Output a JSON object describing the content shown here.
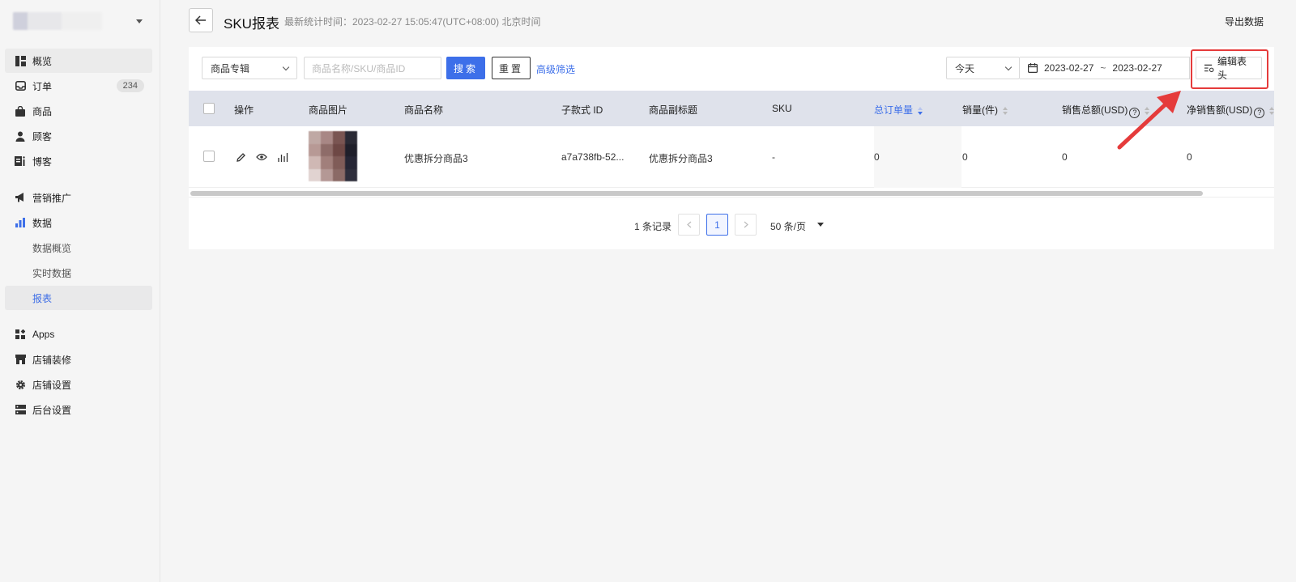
{
  "sidebar": {
    "items": [
      {
        "label": "概览",
        "icon": "dashboard-icon"
      },
      {
        "label": "订单",
        "icon": "inbox-icon",
        "badge": "234"
      },
      {
        "label": "商品",
        "icon": "bag-icon"
      },
      {
        "label": "顾客",
        "icon": "person-icon"
      },
      {
        "label": "博客",
        "icon": "blog-icon"
      }
    ],
    "items2": [
      {
        "label": "营销推广",
        "icon": "megaphone-icon"
      },
      {
        "label": "数据",
        "icon": "bar-chart-icon"
      }
    ],
    "data_sub": [
      {
        "label": "数据概览"
      },
      {
        "label": "实时数据"
      },
      {
        "label": "报表"
      }
    ],
    "items3": [
      {
        "label": "Apps",
        "icon": "apps-icon"
      },
      {
        "label": "店铺装修",
        "icon": "store-icon"
      },
      {
        "label": "店铺设置",
        "icon": "gear-icon"
      },
      {
        "label": "后台设置",
        "icon": "server-icon"
      }
    ]
  },
  "header": {
    "title": "SKU报表",
    "subtitle": "最新统计时间：2023-02-27 15:05:47(UTC+08:00) 北京时间",
    "export": "导出数据"
  },
  "filters": {
    "category_select": "商品专辑",
    "search_placeholder": "商品名称/SKU/商品ID",
    "search_button": "搜索",
    "reset_button": "重置",
    "advanced_link": "高级筛选",
    "date_preset": "今天",
    "date_start": "2023-02-27",
    "date_sep": "~",
    "date_end": "2023-02-27",
    "edit_header": "编辑表头"
  },
  "table": {
    "columns": [
      "操作",
      "商品图片",
      "商品名称",
      "子款式 ID",
      "商品副标题",
      "SKU",
      "总订单量",
      "销量(件)",
      "销售总额(USD)",
      "净销售额(USD)"
    ],
    "rows": [
      {
        "name": "优惠拆分商品3",
        "variant_id": "a7a738fb-52...",
        "subtitle": "优惠拆分商品3",
        "sku": "-",
        "orders": "0",
        "qty": "0",
        "total_sales": "0",
        "net_sales": "0"
      }
    ]
  },
  "pagination": {
    "total": "1 条记录",
    "current_page": "1",
    "page_size": "50 条/页"
  },
  "colors": {
    "primary": "#3d6fe9",
    "highlight": "#e53b3b",
    "header_bg": "#dfe2eb"
  }
}
